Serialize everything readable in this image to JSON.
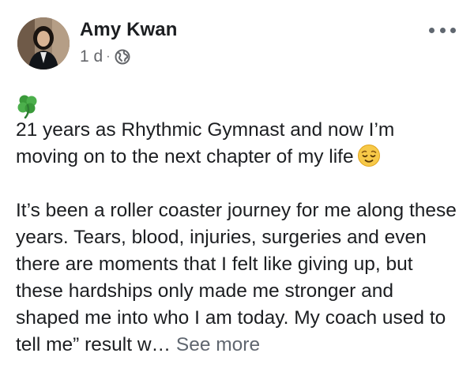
{
  "post": {
    "author_name": "Amy Kwan",
    "time_ago": "1 d",
    "separator": "·",
    "privacy_icon": "globe-icon",
    "more_icon": "more-options-icon",
    "leading_emoji": "four-leaf-clover-icon",
    "paragraph1": "21 years as Rhythmic Gymnast and now I’m moving on to the next chapter of my life",
    "paragraph1_emoji": "relieved-face-icon",
    "paragraph2": "It’s been a roller coaster journey for me along these years. Tears, blood, injuries, surgeries and even there are moments that I felt like giving up, but these hardships only made me stronger and shaped me into who I am today. My coach used to tell me” result w…",
    "see_more_label": "See more"
  },
  "colors": {
    "text": "#1c1e21",
    "secondary_text": "#65676b",
    "background": "#ffffff"
  }
}
